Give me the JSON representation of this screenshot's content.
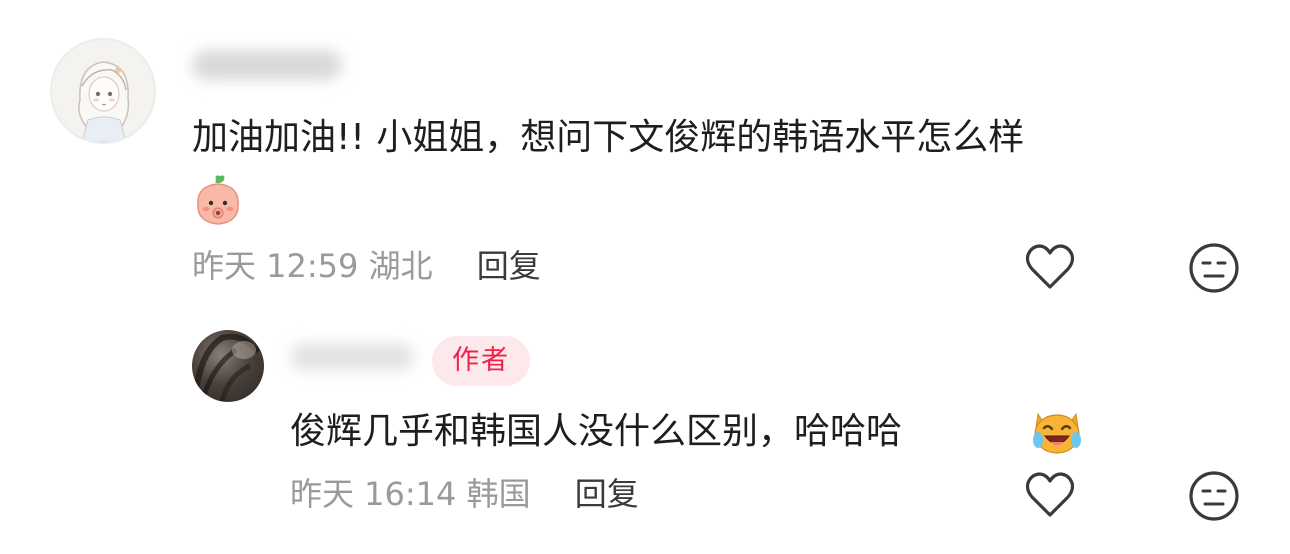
{
  "comment": {
    "text": "加油加油!! 小姐姐，想问下文俊辉的韩语水平怎么样",
    "emoji": "peach-emoji",
    "time": "昨天 12:59",
    "location": "湖北",
    "reply_label": "回复"
  },
  "reply": {
    "author_badge": "作者",
    "text": "俊辉几乎和韩国人没什么区别，哈哈哈",
    "emoji": "laughing-cat-emoji",
    "time": "昨天 16:14",
    "location": "韩国",
    "reply_label": "回复"
  },
  "icons": {
    "like": "heart-outline-icon",
    "dislike": "meh-face-icon"
  },
  "colors": {
    "author_badge_bg": "#fde9ec",
    "author_badge_text": "#f0224a",
    "meta_text": "#9a9a9a"
  }
}
